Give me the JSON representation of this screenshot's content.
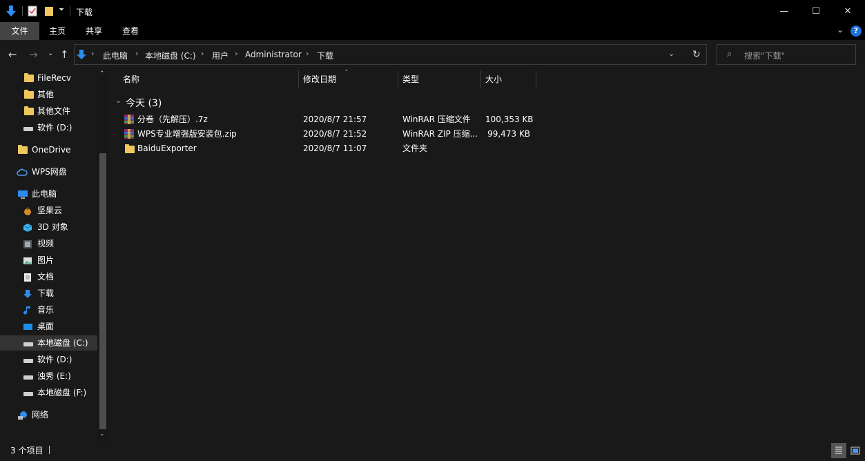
{
  "window": {
    "title": "下载",
    "minimize": "—",
    "maximize": "☐",
    "close": "✕"
  },
  "ribbon": {
    "tabs": [
      {
        "label": "文件",
        "active": true
      },
      {
        "label": "主页",
        "active": false
      },
      {
        "label": "共享",
        "active": false
      },
      {
        "label": "查看",
        "active": false
      }
    ]
  },
  "address": {
    "breadcrumbs": [
      "此电脑",
      "本地磁盘 (C:)",
      "用户",
      "Administrator",
      "下载"
    ],
    "search_placeholder": "搜索\"下载\""
  },
  "sidebar": {
    "items": [
      {
        "label": "FileRecv",
        "icon": "folder-icon"
      },
      {
        "label": "其他",
        "icon": "folder-icon"
      },
      {
        "label": "其他文件",
        "icon": "folder-icon"
      },
      {
        "label": "软件 (D:)",
        "icon": "drive-icon"
      },
      {
        "label": "OneDrive",
        "icon": "folder-icon"
      },
      {
        "label": "WPS网盘",
        "icon": "cloud-icon"
      },
      {
        "label": "此电脑",
        "icon": "computer-icon"
      },
      {
        "label": "坚果云",
        "icon": "nut-icon"
      },
      {
        "label": "3D 对象",
        "icon": "cube-icon"
      },
      {
        "label": "视频",
        "icon": "video-icon"
      },
      {
        "label": "图片",
        "icon": "picture-icon"
      },
      {
        "label": "文档",
        "icon": "document-icon"
      },
      {
        "label": "下载",
        "icon": "download-icon"
      },
      {
        "label": "音乐",
        "icon": "music-icon"
      },
      {
        "label": "桌面",
        "icon": "desktop-icon"
      },
      {
        "label": "本地磁盘 (C:)",
        "icon": "drive-icon",
        "selected": true
      },
      {
        "label": "软件 (D:)",
        "icon": "drive-icon"
      },
      {
        "label": "浊秀 (E:)",
        "icon": "drive-icon"
      },
      {
        "label": "本地磁盘 (F:)",
        "icon": "drive-icon"
      },
      {
        "label": "网络",
        "icon": "network-icon"
      }
    ]
  },
  "columns": {
    "name": "名称",
    "modified": "修改日期",
    "type": "类型",
    "size": "大小"
  },
  "group": {
    "label": "今天 (3)"
  },
  "files": [
    {
      "name": "分卷（先解压）.7z",
      "modified": "2020/8/7 21:57",
      "type": "WinRAR 压缩文件",
      "size": "100,353 KB",
      "icon": "winrar-icon"
    },
    {
      "name": "WPS专业增强版安装包.zip",
      "modified": "2020/8/7 21:52",
      "type": "WinRAR ZIP 压缩...",
      "size": "99,473 KB",
      "icon": "winrar-icon"
    },
    {
      "name": "BaiduExporter",
      "modified": "2020/8/7 11:07",
      "type": "文件夹",
      "size": "",
      "icon": "folder-icon"
    }
  ],
  "status": {
    "count": "3 个项目"
  },
  "colors": {
    "folder": "#f0c75e",
    "accent": "#1e90ff",
    "background": "#191919"
  }
}
